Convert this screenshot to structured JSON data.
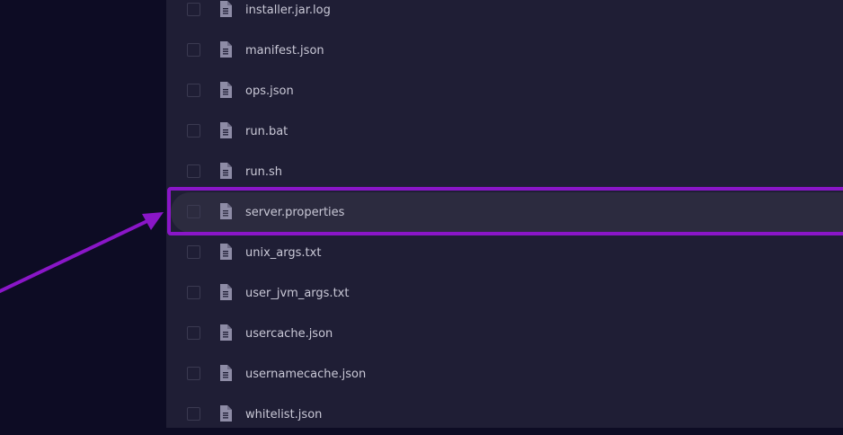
{
  "file_list": {
    "items": [
      {
        "name": "installer.jar.log",
        "icon": "file-icon"
      },
      {
        "name": "manifest.json",
        "icon": "file-icon"
      },
      {
        "name": "ops.json",
        "icon": "file-icon"
      },
      {
        "name": "run.bat",
        "icon": "file-icon"
      },
      {
        "name": "run.sh",
        "icon": "file-icon"
      },
      {
        "name": "server.properties",
        "icon": "file-icon",
        "highlighted": true
      },
      {
        "name": "unix_args.txt",
        "icon": "file-icon"
      },
      {
        "name": "user_jvm_args.txt",
        "icon": "file-icon"
      },
      {
        "name": "usercache.json",
        "icon": "file-icon"
      },
      {
        "name": "usernamecache.json",
        "icon": "file-icon"
      },
      {
        "name": "whitelist.json",
        "icon": "file-icon"
      }
    ]
  },
  "colors": {
    "sidebar_bg": "#0d0c24",
    "panel_bg": "#1f1e35",
    "highlight_row_bg": "#2c2b3f",
    "callout": "#8a16c8",
    "text": "#c9c8d6",
    "icon": "#8e8ca6"
  }
}
